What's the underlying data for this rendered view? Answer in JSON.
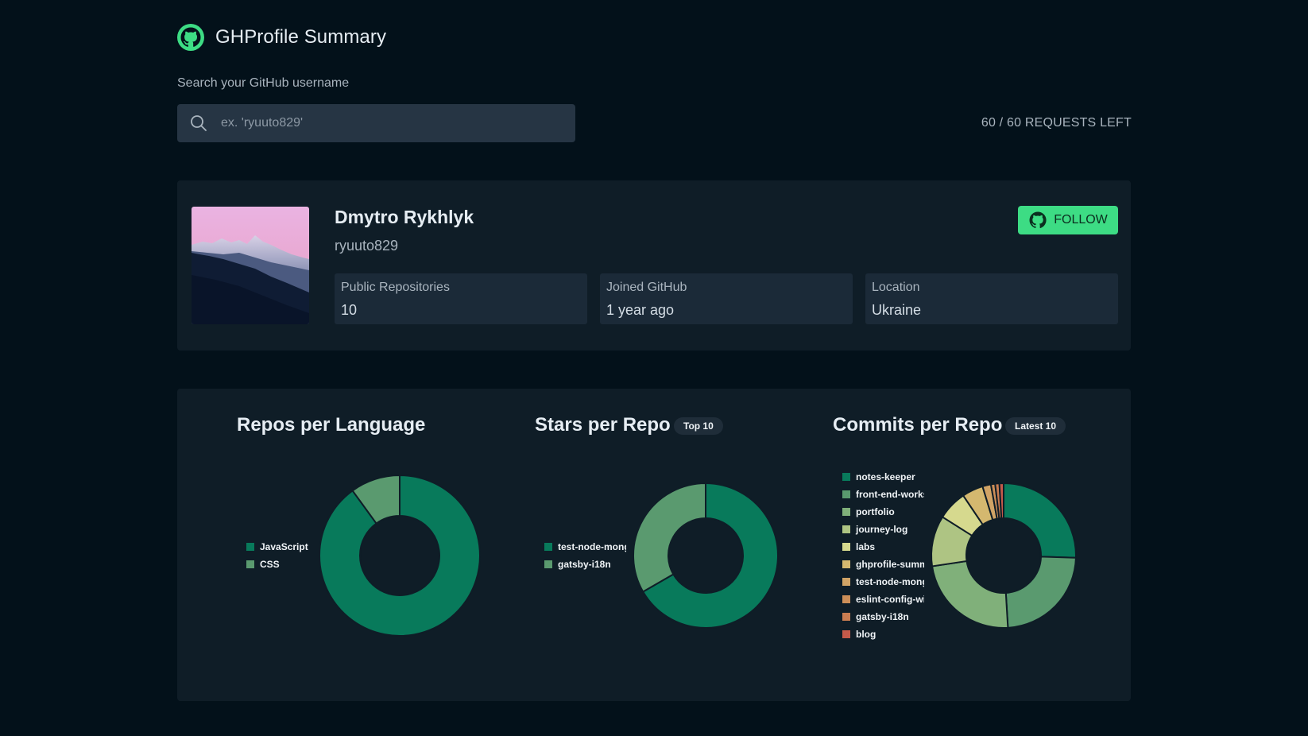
{
  "app": {
    "title": "GHProfile Summary",
    "search_label": "Search your GitHub username",
    "search_placeholder": "ex. 'ryuuto829'",
    "search_value": "",
    "requests_left": "60 / 60 REQUESTS LEFT"
  },
  "profile": {
    "name": "Dmytro Rykhlyk",
    "login": "ryuuto829",
    "follow_label": "FOLLOW",
    "stats": [
      {
        "label": "Public Repositories",
        "value": "10"
      },
      {
        "label": "Joined GitHub",
        "value": "1 year ago"
      },
      {
        "label": "Location",
        "value": "Ukraine"
      }
    ]
  },
  "colors": {
    "background": "#03111a",
    "card": "#0f1d27",
    "accent": "#3ddc84"
  },
  "icons": [
    "github-logo-icon",
    "search-icon",
    "github-icon"
  ],
  "charts": {
    "languages": {
      "title": "Repos per Language",
      "badge": ""
    },
    "stars": {
      "title": "Stars per Repo",
      "badge": "Top 10"
    },
    "commits": {
      "title": "Commits per Repo",
      "badge": "Latest 10"
    }
  },
  "chart_data": [
    {
      "type": "pie",
      "title": "Repos per Language",
      "categories": [
        "JavaScript",
        "CSS"
      ],
      "values": [
        9,
        1
      ],
      "colors": [
        "#087a5b",
        "#5a9a6f"
      ],
      "legend_position": "left"
    },
    {
      "type": "pie",
      "title": "Stars per Repo",
      "categories": [
        "test-node-mongo",
        "gatsby-i18n"
      ],
      "values": [
        2,
        1
      ],
      "colors": [
        "#087a5b",
        "#5a9a6f"
      ],
      "legend_position": "left"
    },
    {
      "type": "pie",
      "title": "Commits per Repo",
      "categories": [
        "notes-keeper",
        "front-end-workspace",
        "portfolio",
        "journey-log",
        "labs",
        "ghprofile-summary",
        "test-node-mongo",
        "eslint-config-with",
        "gatsby-i18n",
        "blog"
      ],
      "values": [
        27,
        25,
        25,
        12,
        7,
        5,
        2,
        1,
        1,
        1
      ],
      "colors": [
        "#087a5b",
        "#5a9a6f",
        "#80b07a",
        "#aec483",
        "#d6d98e",
        "#d4b86f",
        "#d1a466",
        "#cc8e58",
        "#c97d51",
        "#c45a4a"
      ],
      "legend_position": "left"
    }
  ]
}
